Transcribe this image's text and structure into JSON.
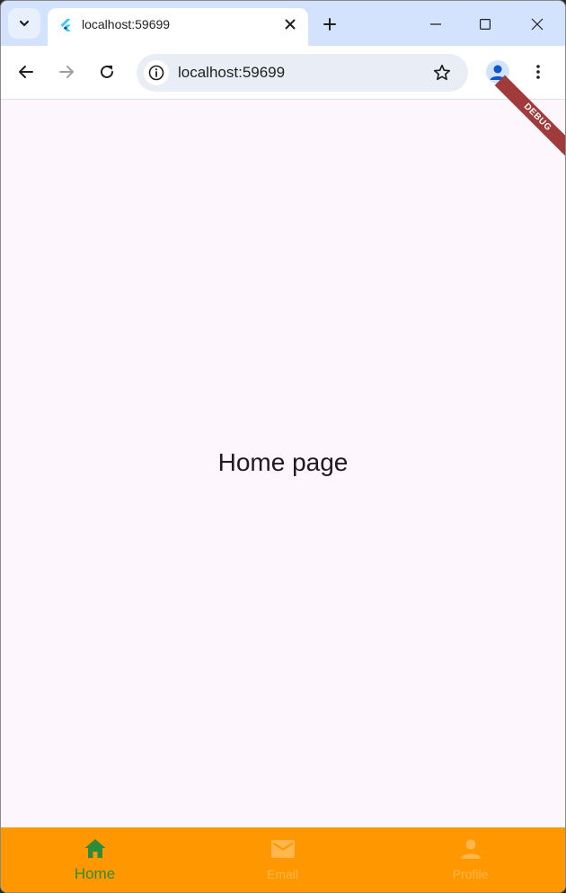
{
  "browser": {
    "tab_title": "localhost:59699",
    "url": "localhost:59699"
  },
  "icons": {
    "tab_search": "chevron-down-icon",
    "favicon": "flutter-icon",
    "tab_close": "close-icon",
    "new_tab": "plus-icon",
    "minimize": "minimize-icon",
    "maximize": "maximize-icon",
    "close_window": "close-icon",
    "back": "arrow-left-icon",
    "forward": "arrow-right-icon",
    "reload": "reload-icon",
    "site_info": "info-icon",
    "bookmark": "star-icon",
    "profile": "person-icon",
    "menu": "kebab-menu-icon"
  },
  "page": {
    "heading": "Home page",
    "debug_banner": "DEBUG"
  },
  "bottom_nav": {
    "items": [
      {
        "label": "Home",
        "icon": "home-icon",
        "active": true
      },
      {
        "label": "Email",
        "icon": "email-icon",
        "active": false
      },
      {
        "label": "Profile",
        "icon": "person-icon",
        "active": false
      }
    ]
  },
  "colors": {
    "tabstrip_bg": "#d3e3fd",
    "page_bg": "#fdf6fd",
    "nav_bg": "#ff9800",
    "nav_active": "#2e8b3b",
    "nav_inactive": "#ffb64a",
    "debug_banner": "#a13a3a"
  }
}
